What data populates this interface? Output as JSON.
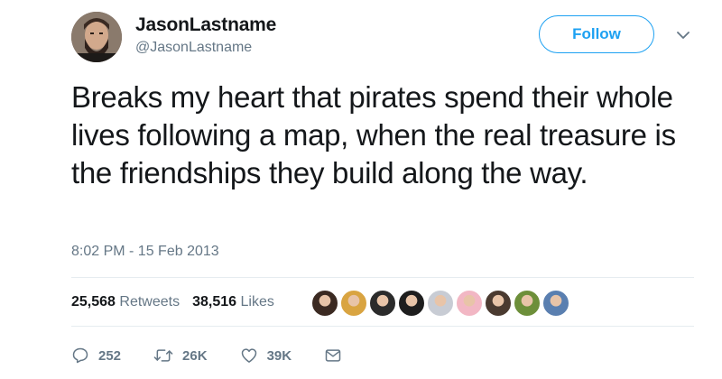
{
  "user": {
    "display_name": "JasonLastname",
    "handle": "@JasonLastname"
  },
  "follow_label": "Follow",
  "tweet": {
    "text": "Breaks my heart that pirates spend their whole lives following a map, when the real treasure is the friendships they build along the way.",
    "timestamp": "8:02 PM - 15 Feb 2013"
  },
  "stats": {
    "retweets_count": "25,568",
    "retweets_label": "Retweets",
    "likes_count": "38,516",
    "likes_label": "Likes"
  },
  "liker_avatars": [
    {
      "color": "#3b2a22"
    },
    {
      "color": "#d9a441"
    },
    {
      "color": "#2b2b2b"
    },
    {
      "color": "#1e1e1e"
    },
    {
      "color": "#c8ccd4"
    },
    {
      "color": "#f2b7c4"
    },
    {
      "color": "#4a3a30"
    },
    {
      "color": "#6d8f3a"
    },
    {
      "color": "#5a7fb0"
    }
  ],
  "actions": {
    "replies": "252",
    "retweets": "26K",
    "likes": "39K"
  },
  "colors": {
    "accent": "#1da1f2",
    "text": "#14171a",
    "muted": "#657786",
    "divider": "#e6ecf0"
  },
  "icons": [
    "reply-icon",
    "retweet-icon",
    "heart-icon",
    "message-icon",
    "chevron-down-icon"
  ]
}
